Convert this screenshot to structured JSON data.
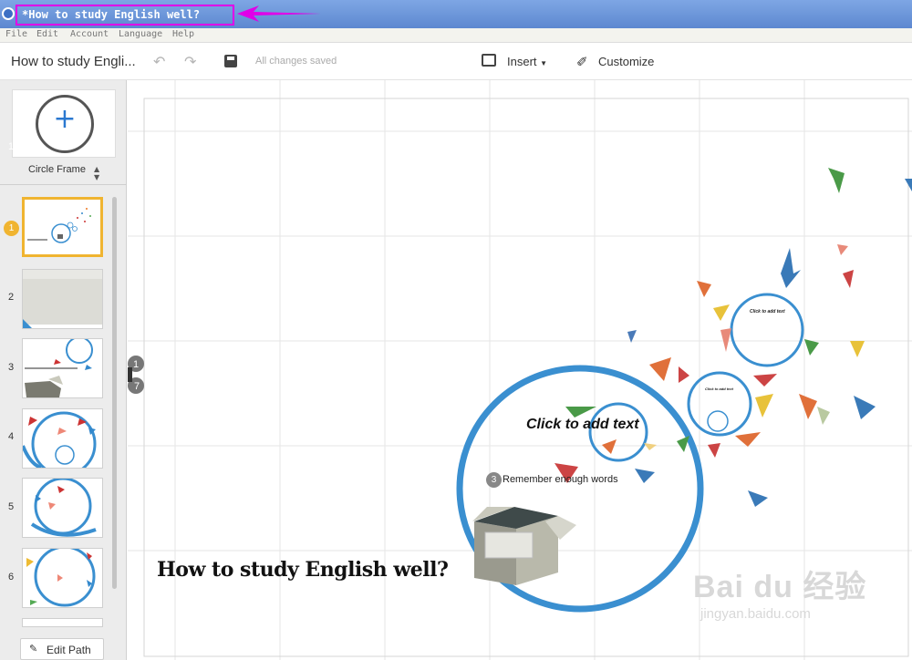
{
  "window": {
    "title": "*How to study English well?"
  },
  "menu": [
    "File",
    "Edit",
    "Account",
    "Language",
    "Help"
  ],
  "toolbar": {
    "doc_title": "How to study Engli...",
    "save_status": "All changes saved",
    "insert_label": "Insert",
    "customize_label": "Customize"
  },
  "sidebar": {
    "frame_type": "Circle Frame",
    "current_step": "1",
    "thumbnails": [
      {
        "num": "1",
        "active": true
      },
      {
        "num": "2",
        "active": false
      },
      {
        "num": "3",
        "active": false
      },
      {
        "num": "4",
        "active": false
      },
      {
        "num": "5",
        "active": false
      },
      {
        "num": "6",
        "active": false
      }
    ],
    "edit_path_label": "Edit Path"
  },
  "canvas": {
    "title": "How to study English well?",
    "click_to_add": "Click to add text",
    "step3_badge": "3",
    "step3_text": "Remember enough words",
    "small_circle_title": "Click to add text",
    "small_circle_sub": "Click to add text",
    "handle_numbers": [
      "1",
      "7"
    ]
  },
  "watermark": {
    "main": "Bai du 经验",
    "sub": "jingyan.baidu.com"
  },
  "colors": {
    "accent_blue": "#3a8fd0",
    "title_highlight": "#e000e8",
    "step_badge": "#f0b430"
  }
}
